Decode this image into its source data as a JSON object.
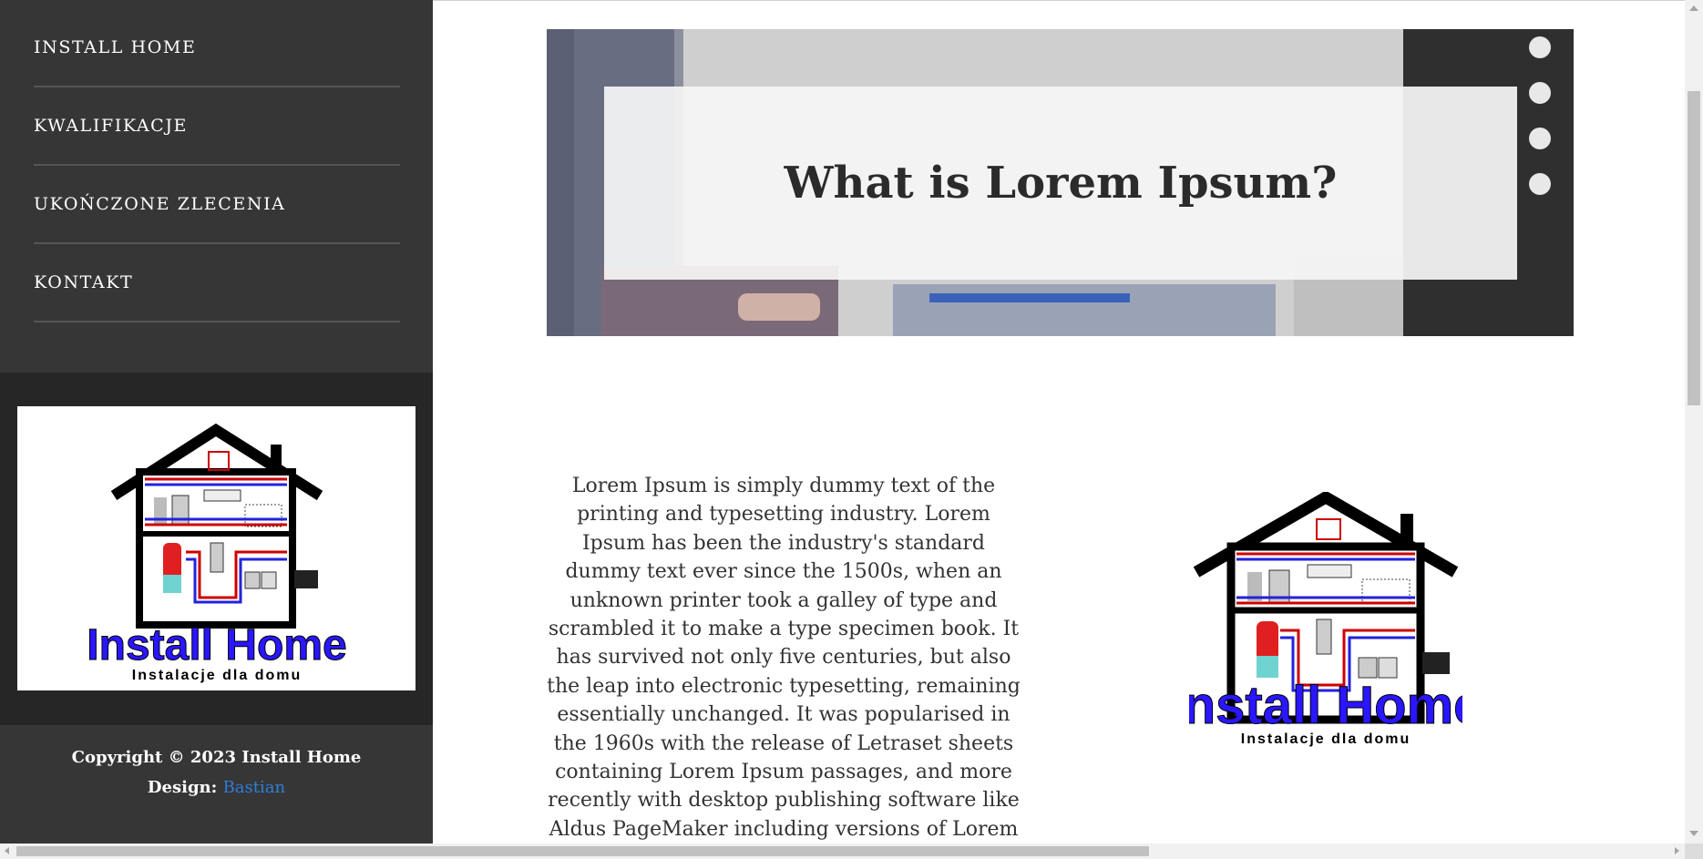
{
  "sidebar": {
    "nav": [
      {
        "label": "INSTALL HOME"
      },
      {
        "label": "KWALIFIKACJE"
      },
      {
        "label": "UKOŃCZONE ZLECENIA"
      },
      {
        "label": "KONTAKT"
      }
    ],
    "logo": {
      "brand": "Install Home",
      "tagline": "Instalacje dla domu"
    },
    "footer": {
      "copyright": "Copyright © 2023 Install Home",
      "design_label": "Design:",
      "designer": "Bastian"
    }
  },
  "hero": {
    "title": "What is Lorem Ipsum?"
  },
  "main": {
    "paragraph": "Lorem Ipsum is simply dummy text of the printing and typesetting industry. Lorem Ipsum has been the industry's standard dummy text ever since the 1500s, when an unknown printer took a galley of type and scrambled it to make a type specimen book. It has survived not only five centuries, but also the leap into electronic typesetting, remaining essentially unchanged. It was popularised in the 1960s with the release of Letraset sheets containing Lorem Ipsum passages, and more recently with desktop publishing software like Aldus PageMaker including versions of Lorem Ipsum.",
    "logo": {
      "brand": "Install Home",
      "tagline": "Instalacje dla domu"
    }
  },
  "colors": {
    "sidebar": "#363636",
    "logo_band": "#262626",
    "link": "#2e7fd9",
    "brand_blue": "#2a16ff"
  }
}
